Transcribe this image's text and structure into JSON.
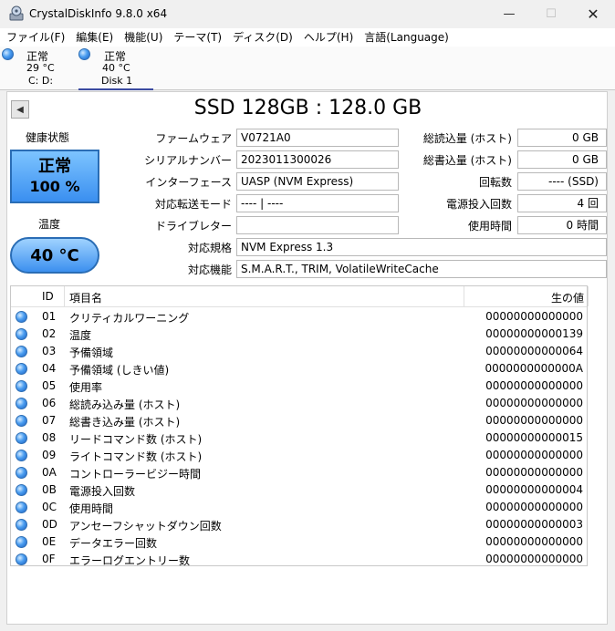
{
  "window": {
    "title": "CrystalDiskInfo 9.8.0 x64",
    "minimize": "—",
    "maximize": "☐",
    "close": "✕"
  },
  "menu": [
    "ファイル(F)",
    "編集(E)",
    "機能(U)",
    "テーマ(T)",
    "ディスク(D)",
    "ヘルプ(H)",
    "言語(Language)"
  ],
  "disk_tabs": [
    {
      "status": "正常",
      "temp": "29 °C",
      "label": "C: D:"
    },
    {
      "status": "正常",
      "temp": "40 °C",
      "label": "Disk 1"
    }
  ],
  "disk": {
    "title": "SSD 128GB : 128.0 GB",
    "health_label": "健康状態",
    "health_status": "正常",
    "health_percent": "100 %",
    "temp_label": "温度",
    "temp_value": "40 °C"
  },
  "info_left": [
    {
      "label": "ファームウェア",
      "value": "V0721A0"
    },
    {
      "label": "シリアルナンバー",
      "value": "2023011300026"
    },
    {
      "label": "インターフェース",
      "value": "UASP (NVM Express)"
    },
    {
      "label": "対応転送モード",
      "value": "---- | ----"
    },
    {
      "label": "ドライブレター",
      "value": ""
    }
  ],
  "info_right": [
    {
      "label": "総読込量 (ホスト)",
      "value": "0 GB"
    },
    {
      "label": "総書込量 (ホスト)",
      "value": "0 GB"
    },
    {
      "label": "回転数",
      "value": "---- (SSD)"
    },
    {
      "label": "電源投入回数",
      "value": "4 回"
    },
    {
      "label": "使用時間",
      "value": "0 時間"
    }
  ],
  "info_wide": [
    {
      "label": "対応規格",
      "value": "NVM Express 1.3"
    },
    {
      "label": "対応機能",
      "value": "S.M.A.R.T., TRIM, VolatileWriteCache"
    }
  ],
  "smart": {
    "headers": {
      "id": "ID",
      "name": "項目名",
      "raw": "生の値"
    },
    "rows": [
      {
        "id": "01",
        "name": "クリティカルワーニング",
        "raw": "00000000000000"
      },
      {
        "id": "02",
        "name": "温度",
        "raw": "00000000000139"
      },
      {
        "id": "03",
        "name": "予備領域",
        "raw": "00000000000064"
      },
      {
        "id": "04",
        "name": "予備領域 (しきい値)",
        "raw": "0000000000000A"
      },
      {
        "id": "05",
        "name": "使用率",
        "raw": "00000000000000"
      },
      {
        "id": "06",
        "name": "総読み込み量 (ホスト)",
        "raw": "00000000000000"
      },
      {
        "id": "07",
        "name": "総書き込み量 (ホスト)",
        "raw": "00000000000000"
      },
      {
        "id": "08",
        "name": "リードコマンド数 (ホスト)",
        "raw": "00000000000015"
      },
      {
        "id": "09",
        "name": "ライトコマンド数 (ホスト)",
        "raw": "00000000000000"
      },
      {
        "id": "0A",
        "name": "コントローラービジー時間",
        "raw": "00000000000000"
      },
      {
        "id": "0B",
        "name": "電源投入回数",
        "raw": "00000000000004"
      },
      {
        "id": "0C",
        "name": "使用時間",
        "raw": "00000000000000"
      },
      {
        "id": "0D",
        "name": "アンセーフシャットダウン回数",
        "raw": "00000000000003"
      },
      {
        "id": "0E",
        "name": "データエラー回数",
        "raw": "00000000000000"
      },
      {
        "id": "0F",
        "name": "エラーログエントリー数",
        "raw": "00000000000000"
      }
    ]
  }
}
